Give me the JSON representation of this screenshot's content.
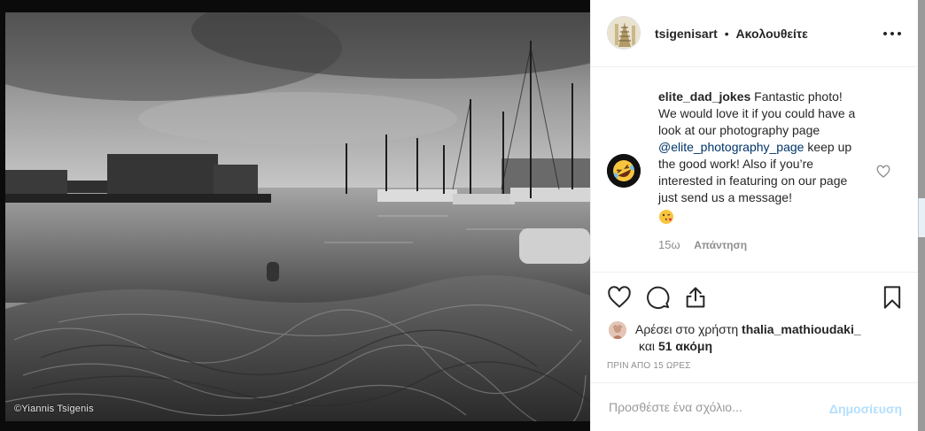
{
  "photo": {
    "watermark": "©Yiannis Tsigenis"
  },
  "header": {
    "username": "tsigenisart",
    "separator": "•",
    "follow_label": "Ακολουθείτε"
  },
  "comment": {
    "username": "elite_dad_jokes",
    "text_before_mention": "Fantastic photo! We would love it if you could have a look at our photography page",
    "mention": "@elite_photography_page",
    "text_after_mention": "keep up the good work! Also if you’re interested in featuring on our page just send us a message!",
    "age": "15ω",
    "reply_label": "Απάντηση"
  },
  "likes": {
    "prefix": "Αρέσει στο χρήστη",
    "liker": "thalia_mathioudaki_",
    "and_label": "και",
    "others": "51 ακόμη"
  },
  "timestamp": "ΠΡΙΝ ΑΠΟ 15 ΩΡΕΣ",
  "add_comment": {
    "placeholder": "Προσθέστε ένα σχόλιο...",
    "post_label": "Δημοσίευση"
  },
  "icons": {
    "more": "more-options-icon",
    "heart": "heart-icon",
    "comment": "comment-icon",
    "share": "share-icon",
    "save": "bookmark-icon",
    "emoji_avatar": "rofl-emoji-icon",
    "emoji_wink": "kissing-wink-emoji-icon"
  }
}
